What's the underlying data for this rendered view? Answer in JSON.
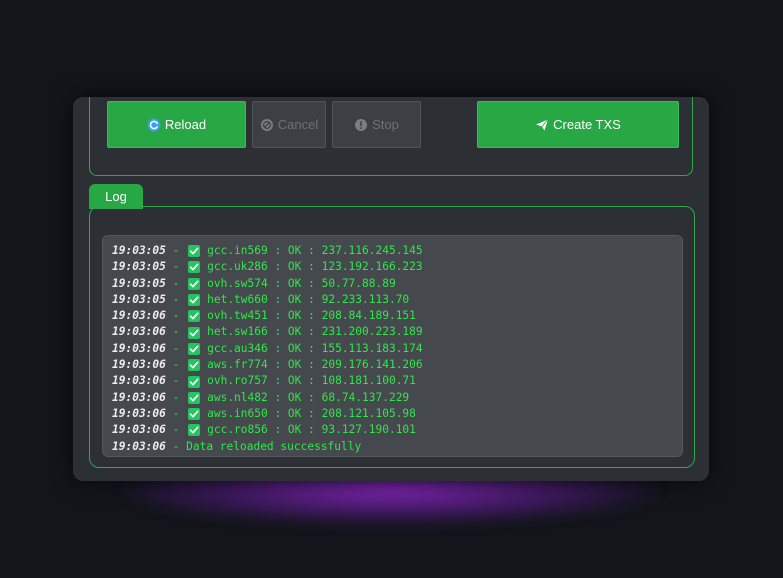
{
  "toolbar": {
    "reload_label": "Reload",
    "cancel_label": "Cancel",
    "stop_label": "Stop",
    "create_label": "Create TXS"
  },
  "log": {
    "tab_label": "Log",
    "separator": " - ",
    "lines": [
      {
        "time": "19:03:05",
        "status_icon": "checkmark-icon",
        "text": "gcc.in569 : OK : 237.116.245.145"
      },
      {
        "time": "19:03:05",
        "status_icon": "checkmark-icon",
        "text": "gcc.uk286 : OK : 123.192.166.223"
      },
      {
        "time": "19:03:05",
        "status_icon": "checkmark-icon",
        "text": "ovh.sw574 : OK : 50.77.88.89"
      },
      {
        "time": "19:03:05",
        "status_icon": "checkmark-icon",
        "text": "het.tw660 : OK : 92.233.113.70"
      },
      {
        "time": "19:03:06",
        "status_icon": "checkmark-icon",
        "text": "ovh.tw451 : OK : 208.84.189.151"
      },
      {
        "time": "19:03:06",
        "status_icon": "checkmark-icon",
        "text": "het.sw166 : OK : 231.200.223.189"
      },
      {
        "time": "19:03:06",
        "status_icon": "checkmark-icon",
        "text": "gcc.au346 : OK : 155.113.183.174"
      },
      {
        "time": "19:03:06",
        "status_icon": "checkmark-icon",
        "text": "aws.fr774 : OK : 209.176.141.206"
      },
      {
        "time": "19:03:06",
        "status_icon": "checkmark-icon",
        "text": "ovh.ro757 : OK : 108.181.100.71"
      },
      {
        "time": "19:03:06",
        "status_icon": "checkmark-icon",
        "text": "aws.nl482 : OK : 68.74.137.229"
      },
      {
        "time": "19:03:06",
        "status_icon": "checkmark-icon",
        "text": "aws.in650 : OK : 208.121.105.98"
      },
      {
        "time": "19:03:06",
        "status_icon": "checkmark-icon",
        "text": "gcc.ro856 : OK : 93.127.190.101"
      },
      {
        "time": "19:03:06",
        "status_icon": "",
        "text": "Data reloaded successfully"
      }
    ]
  },
  "colors": {
    "accent_green": "#28a745",
    "log_text": "#2ee84a",
    "timestamp_text": "#ececec",
    "window_bg": "#2c2f33",
    "glow": "#9628d2"
  }
}
